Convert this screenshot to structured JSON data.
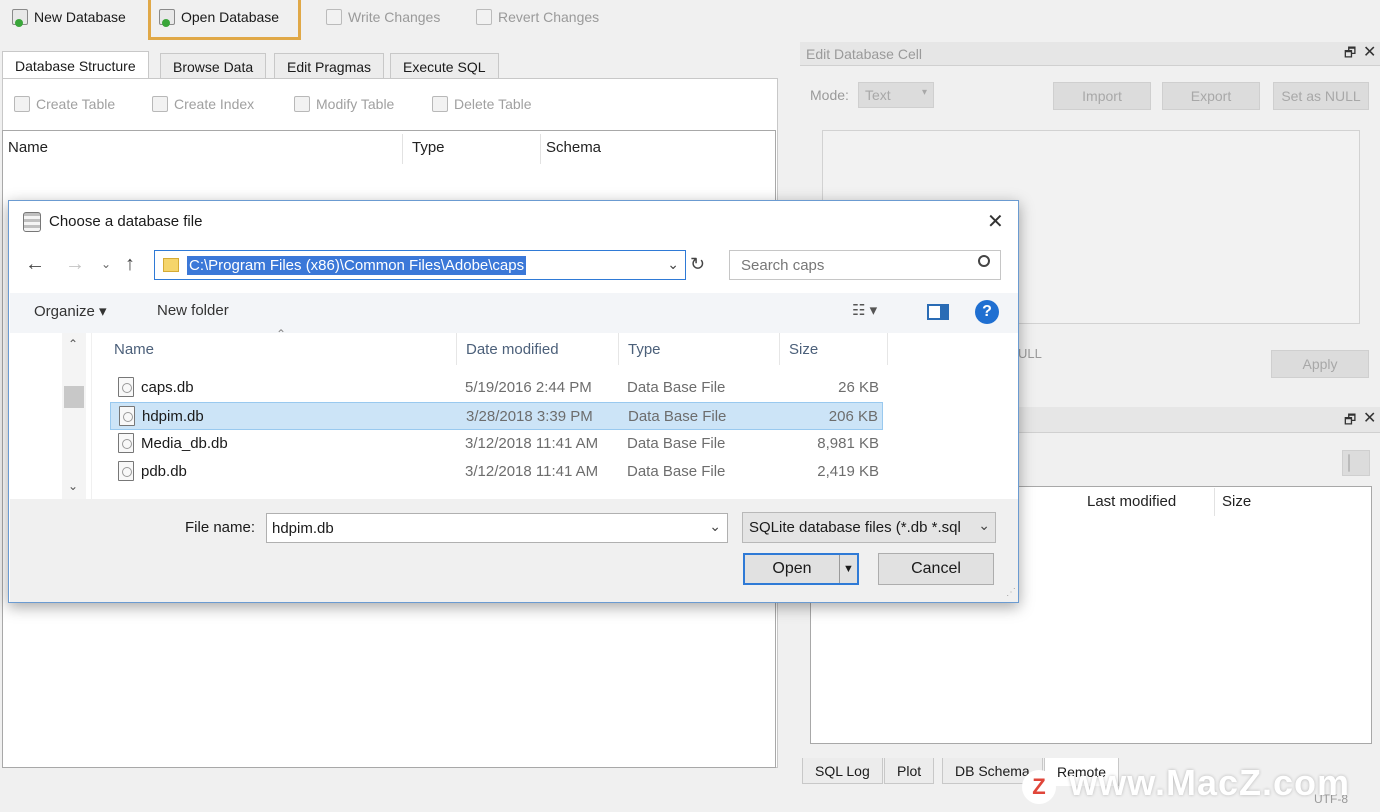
{
  "toolbar": {
    "new_database": "New Database",
    "open_database": "Open Database",
    "write_changes": "Write Changes",
    "revert_changes": "Revert Changes"
  },
  "main_tabs": [
    "Database Structure",
    "Browse Data",
    "Edit Pragmas",
    "Execute SQL"
  ],
  "structure_toolbar": {
    "create_table": "Create Table",
    "create_index": "Create Index",
    "modify_table": "Modify Table",
    "delete_table": "Delete Table"
  },
  "structure_columns": [
    "Name",
    "Type",
    "Schema"
  ],
  "edit_cell": {
    "title": "Edit Database Cell",
    "mode_label": "Mode:",
    "mode_value": "Text",
    "import": "Import",
    "export": "Export",
    "set_null": "Set as NULL",
    "null_text": "ULL",
    "apply": "Apply"
  },
  "remote": {
    "columns": [
      "Last modified",
      "Size"
    ]
  },
  "bottom_tabs": [
    "SQL Log",
    "Plot",
    "DB Schema",
    "Remote"
  ],
  "status_text": "UTF-8",
  "dialog": {
    "title": "Choose a database file",
    "path": "C:\\Program Files (x86)\\Common Files\\Adobe\\caps",
    "search_placeholder": "Search caps",
    "organize": "Organize",
    "new_folder": "New folder",
    "columns": {
      "name": "Name",
      "date": "Date modified",
      "type": "Type",
      "size": "Size"
    },
    "files": [
      {
        "name": "caps.db",
        "date": "5/19/2016 2:44 PM",
        "type": "Data Base File",
        "size": "26 KB",
        "selected": false
      },
      {
        "name": "hdpim.db",
        "date": "3/28/2018 3:39 PM",
        "type": "Data Base File",
        "size": "206 KB",
        "selected": true
      },
      {
        "name": "Media_db.db",
        "date": "3/12/2018 11:41 AM",
        "type": "Data Base File",
        "size": "8,981 KB",
        "selected": false
      },
      {
        "name": "pdb.db",
        "date": "3/12/2018 11:41 AM",
        "type": "Data Base File",
        "size": "2,419 KB",
        "selected": false
      }
    ],
    "file_name_label": "File name:",
    "file_name_value": "hdpim.db",
    "filter_value": "SQLite database files (*.db *.sql",
    "open": "Open",
    "cancel": "Cancel"
  },
  "watermark": "www.MacZ.com",
  "colors": {
    "highlight_border": "#e0a847",
    "selection": "#cce4f7",
    "path_select": "#3b78d8"
  }
}
